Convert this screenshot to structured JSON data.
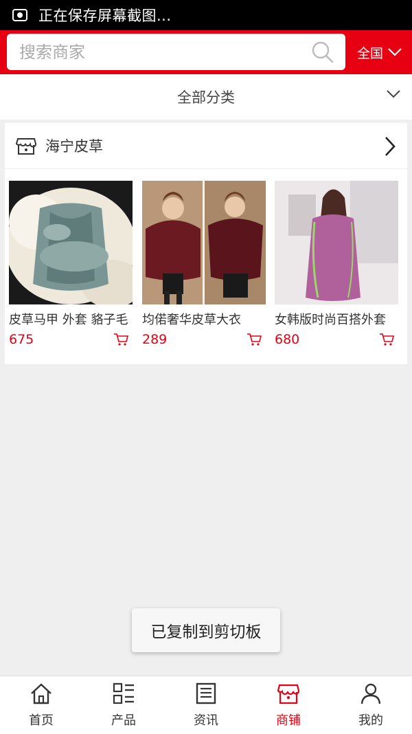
{
  "status_bar": {
    "text": "正在保存屏幕截图..."
  },
  "search": {
    "placeholder": "搜索商家"
  },
  "region": {
    "label": "全国"
  },
  "category": {
    "label": "全部分类"
  },
  "shop": {
    "name": "海宁皮草",
    "products": [
      {
        "name": "皮草马甲 外套 貉子毛",
        "price": "675"
      },
      {
        "name": "均偌奢华皮草大衣",
        "price": "289"
      },
      {
        "name": "女韩版时尚百搭外套",
        "price": "680"
      }
    ]
  },
  "toast": {
    "text": "已复制到剪切板"
  },
  "tabbar": {
    "active": "商铺",
    "tabs": [
      "首页",
      "产品",
      "资讯",
      "商铺",
      "我的"
    ]
  },
  "colors": {
    "brand": "#e60012"
  }
}
